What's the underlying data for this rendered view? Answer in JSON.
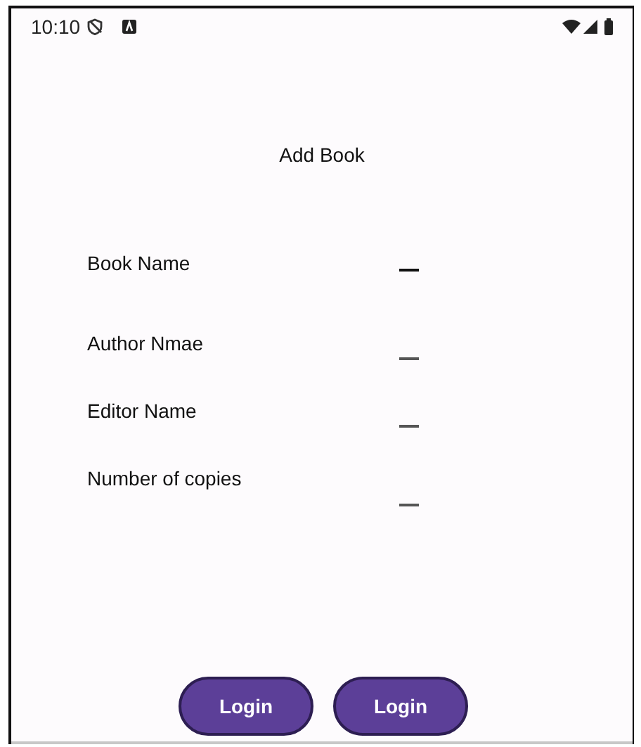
{
  "status_bar": {
    "time": "10:10"
  },
  "title": "Add Book",
  "fields": [
    {
      "label": "Book Name",
      "focused": true
    },
    {
      "label": "Author Nmae",
      "focused": false
    },
    {
      "label": "Editor Name",
      "focused": false
    },
    {
      "label": "Number of copies",
      "focused": false
    }
  ],
  "buttons": [
    "Login",
    "Login"
  ]
}
